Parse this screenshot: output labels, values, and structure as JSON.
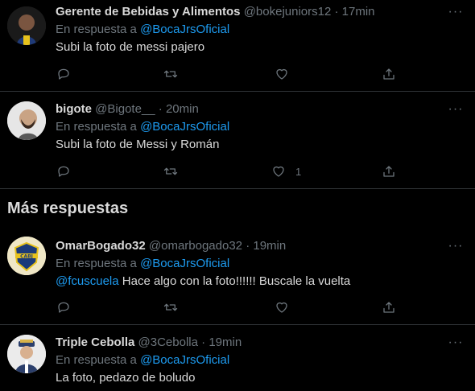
{
  "tweets": [
    {
      "name": "Gerente de Bebidas y Alimentos",
      "handle": "@bokejuniors12",
      "sep": "·",
      "time": "17min",
      "reply_prefix": "En respuesta a",
      "reply_to": "@BocaJrsOficial",
      "text": "Subi la foto de messi pajero",
      "likes": ""
    },
    {
      "name": "bigote",
      "handle": "@Bigote__",
      "sep": "·",
      "time": "20min",
      "reply_prefix": "En respuesta a",
      "reply_to": "@BocaJrsOficial",
      "text": "Subi la foto de Messi y Román",
      "likes": "1"
    }
  ],
  "section_title": "Más respuestas",
  "more_tweets": [
    {
      "name": "OmarBogado32",
      "handle": "@omarbogado32",
      "sep": "·",
      "time": "19min",
      "reply_prefix": "En respuesta a",
      "reply_to": "@BocaJrsOficial",
      "text_mention": "@fcuscuela",
      "text": " Hace algo con la foto!!!!!! Buscale la vuelta",
      "likes": ""
    },
    {
      "name": "Triple Cebolla",
      "handle": "@3Cebolla",
      "sep": "·",
      "time": "19min",
      "reply_prefix": "En respuesta a",
      "reply_to": "@BocaJrsOficial",
      "text": "La foto, pedazo de boludo"
    }
  ],
  "more_icon": "···",
  "colors": {
    "accent": "#1d9bf0",
    "muted": "#6e767d",
    "text": "#d9d9d9",
    "background": "#000000",
    "border": "#2f3336"
  }
}
